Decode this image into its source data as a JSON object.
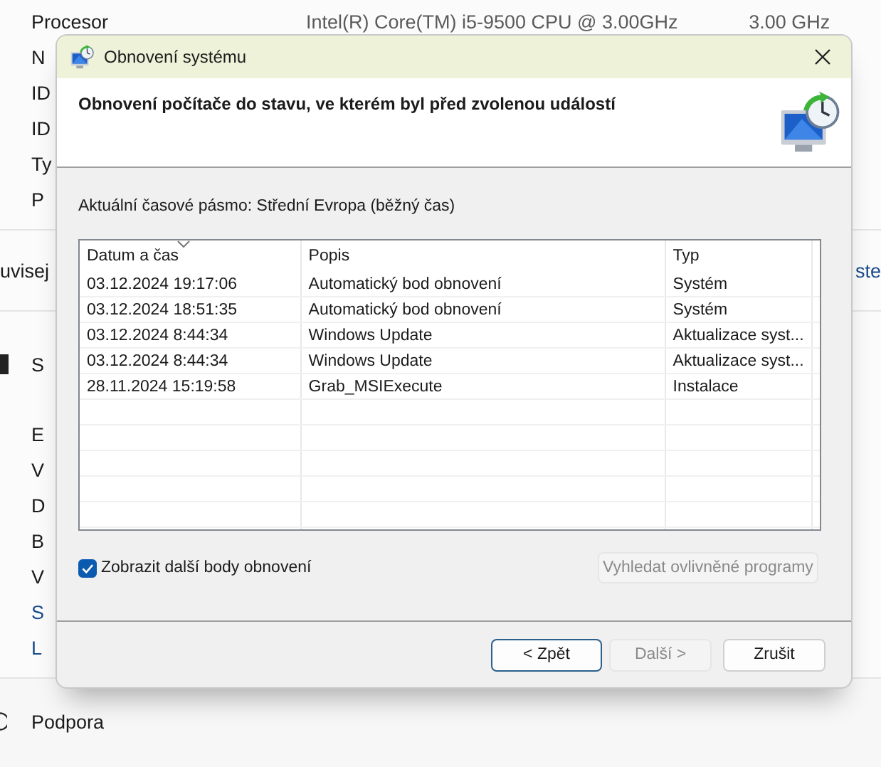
{
  "background": {
    "specs": [
      {
        "label": "Procesor",
        "value": "Intel(R) Core(TM) i5-9500 CPU @ 3.00GHz",
        "value_2": "3.00 GHz"
      },
      {
        "label": "N"
      },
      {
        "label": "ID"
      },
      {
        "label": "ID"
      },
      {
        "label": "Ty"
      },
      {
        "label": "P"
      }
    ],
    "related": {
      "label": "uvisej",
      "link": "ste"
    },
    "section": {
      "label": "S"
    },
    "items": [
      {
        "label": "E",
        "kind": "text"
      },
      {
        "label": "V",
        "kind": "text"
      },
      {
        "label": "D",
        "kind": "text"
      },
      {
        "label": "B",
        "kind": "text"
      },
      {
        "label": "V",
        "kind": "text"
      },
      {
        "label": "S",
        "kind": "link"
      },
      {
        "label": "L",
        "kind": "link"
      }
    ],
    "footer": {
      "label": "Podpora"
    }
  },
  "dialog": {
    "title": "Obnovení systému",
    "heading": "Obnovení počítače do stavu, ve kterém byl před zvolenou událostí",
    "timezone": "Aktuální časové pásmo: Střední Evropa (běžný čas)",
    "table": {
      "columns": [
        {
          "label": "Datum a čas",
          "sorted": true
        },
        {
          "label": "Popis",
          "sorted": false
        },
        {
          "label": "Typ",
          "sorted": false
        }
      ],
      "rows": [
        [
          "03.12.2024 19:17:06",
          "Automatický bod obnovení",
          "Systém"
        ],
        [
          "03.12.2024 18:51:35",
          "Automatický bod obnovení",
          "Systém"
        ],
        [
          "03.12.2024 8:44:34",
          "Windows Update",
          "Aktualizace syst..."
        ],
        [
          "03.12.2024 8:44:34",
          "Windows Update",
          "Aktualizace syst..."
        ],
        [
          "28.11.2024 15:19:58",
          "Grab_MSIExecute",
          "Instalace"
        ]
      ]
    },
    "checkbox": {
      "label": "Zobrazit další body obnovení",
      "checked": true
    },
    "scan_button": {
      "label": "Vyhledat ovlivněné programy",
      "disabled": true
    },
    "buttons": [
      {
        "label": "< Zpět",
        "disabled": false,
        "default": true
      },
      {
        "label": "Další >",
        "disabled": true,
        "default": false
      },
      {
        "label": "Zrušit",
        "disabled": false,
        "default": false
      }
    ]
  }
}
